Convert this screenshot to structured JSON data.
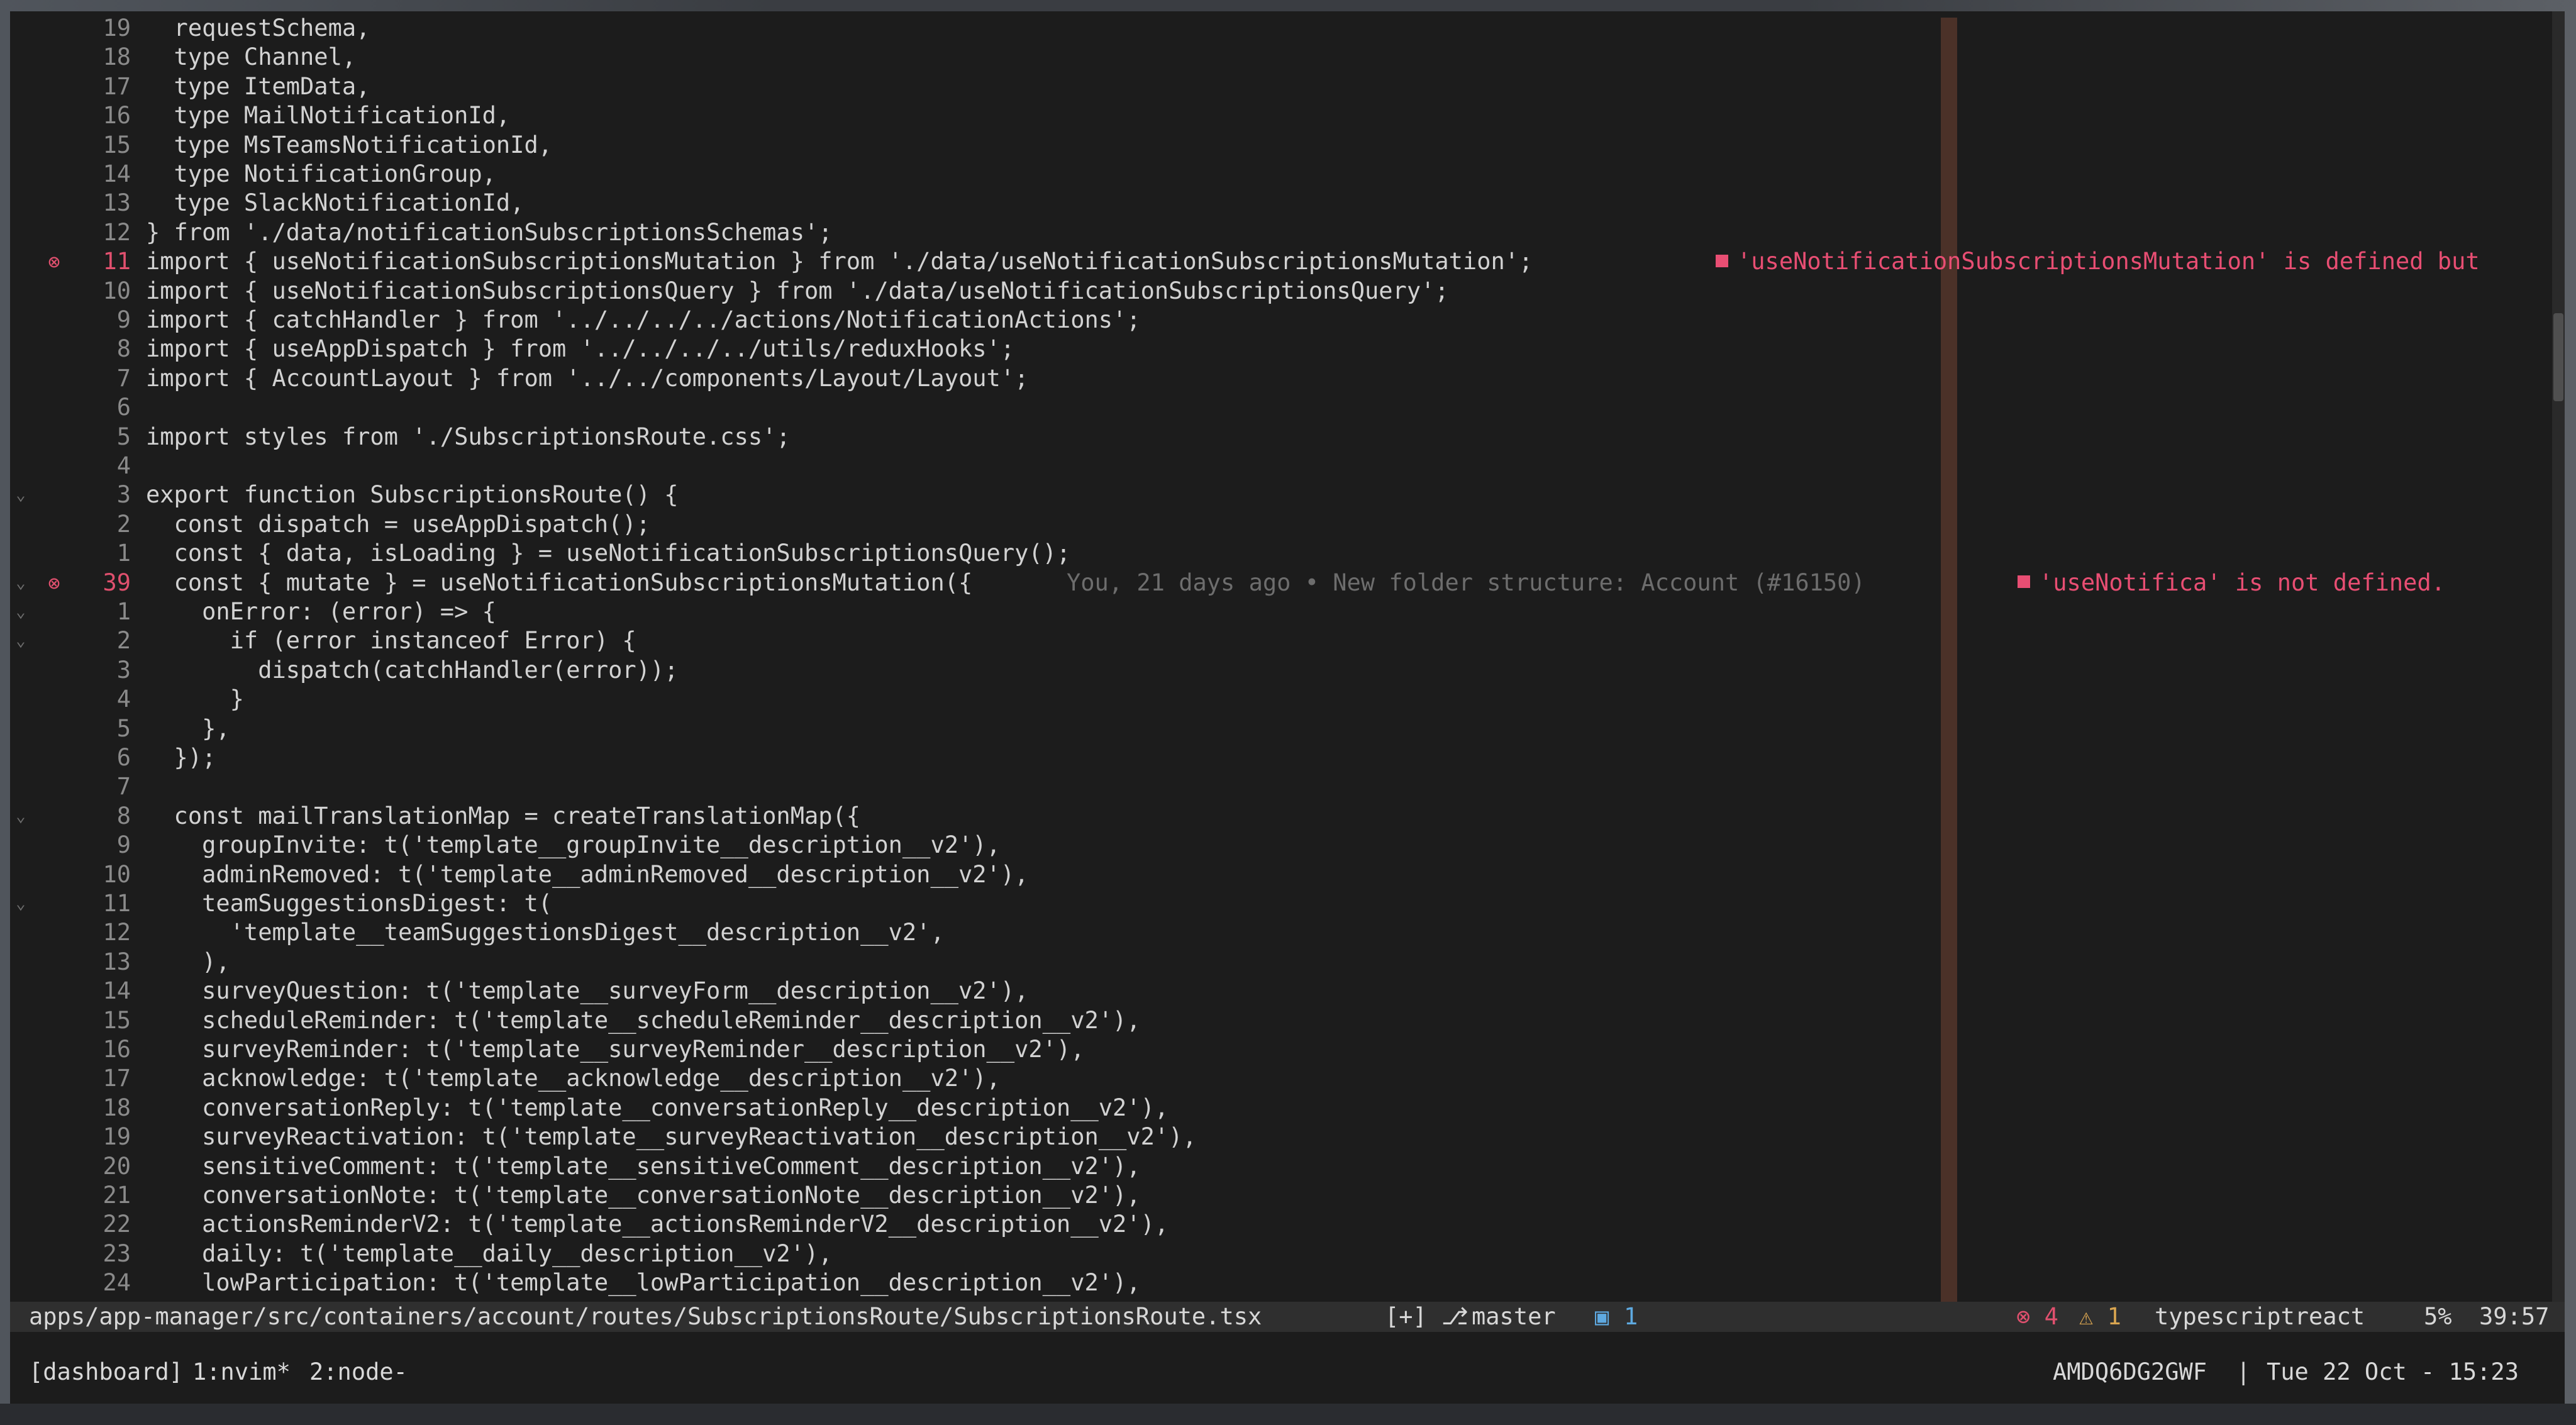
{
  "editor": {
    "lines": [
      {
        "num": "19",
        "text": "  requestSchema,"
      },
      {
        "num": "18",
        "text": "  type Channel,"
      },
      {
        "num": "17",
        "text": "  type ItemData,"
      },
      {
        "num": "16",
        "text": "  type MailNotificationId,"
      },
      {
        "num": "15",
        "text": "  type MsTeamsNotificationId,"
      },
      {
        "num": "14",
        "text": "  type NotificationGroup,"
      },
      {
        "num": "13",
        "text": "  type SlackNotificationId,"
      },
      {
        "num": "12",
        "text": "} from './data/notificationSubscriptionsSchemas';"
      },
      {
        "num": "11",
        "text": "import { useNotificationSubscriptionsMutation } from './data/useNotificationSubscriptionsMutation';",
        "error": true
      },
      {
        "num": "10",
        "text": "import { useNotificationSubscriptionsQuery } from './data/useNotificationSubscriptionsQuery';"
      },
      {
        "num": "9",
        "text": "import { catchHandler } from '../../../../actions/NotificationActions';"
      },
      {
        "num": "8",
        "text": "import { useAppDispatch } from '../../../../utils/reduxHooks';"
      },
      {
        "num": "7",
        "text": "import { AccountLayout } from '../../components/Layout/Layout';"
      },
      {
        "num": "6",
        "text": ""
      },
      {
        "num": "5",
        "text": "import styles from './SubscriptionsRoute.css';"
      },
      {
        "num": "4",
        "text": ""
      },
      {
        "num": "3",
        "text": "export function SubscriptionsRoute() {",
        "fold": true
      },
      {
        "num": "2",
        "text": "  const dispatch = useAppDispatch();"
      },
      {
        "num": "1",
        "text": "  const { data, isLoading } = useNotificationSubscriptionsQuery();"
      },
      {
        "num": "39",
        "text": "  const { mutate } = useNotificationSubscriptionsMutation({",
        "error": true,
        "current": true,
        "fold": true
      },
      {
        "num": "1",
        "text": "    onError: (error) => {",
        "fold": true
      },
      {
        "num": "2",
        "text": "      if (error instanceof Error) {",
        "fold": true
      },
      {
        "num": "3",
        "text": "        dispatch(catchHandler(error));"
      },
      {
        "num": "4",
        "text": "      }"
      },
      {
        "num": "5",
        "text": "    },"
      },
      {
        "num": "6",
        "text": "  });"
      },
      {
        "num": "7",
        "text": ""
      },
      {
        "num": "8",
        "text": "  const mailTranslationMap = createTranslationMap({",
        "fold": true
      },
      {
        "num": "9",
        "text": "    groupInvite: t('template__groupInvite__description__v2'),"
      },
      {
        "num": "10",
        "text": "    adminRemoved: t('template__adminRemoved__description__v2'),"
      },
      {
        "num": "11",
        "text": "    teamSuggestionsDigest: t(",
        "fold": true
      },
      {
        "num": "12",
        "text": "      'template__teamSuggestionsDigest__description__v2',"
      },
      {
        "num": "13",
        "text": "    ),"
      },
      {
        "num": "14",
        "text": "    surveyQuestion: t('template__surveyForm__description__v2'),"
      },
      {
        "num": "15",
        "text": "    scheduleReminder: t('template__scheduleReminder__description__v2'),"
      },
      {
        "num": "16",
        "text": "    surveyReminder: t('template__surveyReminder__description__v2'),"
      },
      {
        "num": "17",
        "text": "    acknowledge: t('template__acknowledge__description__v2'),"
      },
      {
        "num": "18",
        "text": "    conversationReply: t('template__conversationReply__description__v2'),"
      },
      {
        "num": "19",
        "text": "    surveyReactivation: t('template__surveyReactivation__description__v2'),"
      },
      {
        "num": "20",
        "text": "    sensitiveComment: t('template__sensitiveComment__description__v2'),"
      },
      {
        "num": "21",
        "text": "    conversationNote: t('template__conversationNote__description__v2'),"
      },
      {
        "num": "22",
        "text": "    actionsReminderV2: t('template__actionsReminderV2__description__v2'),"
      },
      {
        "num": "23",
        "text": "    daily: t('template__daily__description__v2'),"
      },
      {
        "num": "24",
        "text": "    lowParticipation: t('template__lowParticipation__description__v2'),"
      }
    ],
    "current_line_text_code": "  const { mutate } = useNotificationSubscriptionsMutation({",
    "blame": "You, 21 days ago • New folder structure: Account (#16150)",
    "diagnostics": {
      "line11": "'useNotificationSubscriptionsMutation' is defined but",
      "line39": "'useNotifica' is not defined."
    },
    "error_sign": "⊗"
  },
  "statusline": {
    "path": "apps/app-manager/src/containers/account/routes/SubscriptionsRoute/SubscriptionsRoute.tsx",
    "modified": "[+]",
    "branch_icon": "git-branch-icon",
    "branch": "master",
    "lsp_icon": "lsp-client-icon",
    "lsp_count": "1",
    "errors": "4",
    "warnings": "1",
    "filetype": "typescriptreact",
    "progress": "5%",
    "position": "39:57"
  },
  "tmux": {
    "session": "[dashboard]",
    "win1": "1:nvim*",
    "win2": "2:node-",
    "host": "AMDQ6DG2GWF",
    "separator": "|",
    "datetime": "Tue 22 Oct - 15:23"
  },
  "colors": {
    "background": "#1c1c1c",
    "error": "#e0506e",
    "warning": "#d9a550",
    "lsp": "#5ea9e0"
  }
}
